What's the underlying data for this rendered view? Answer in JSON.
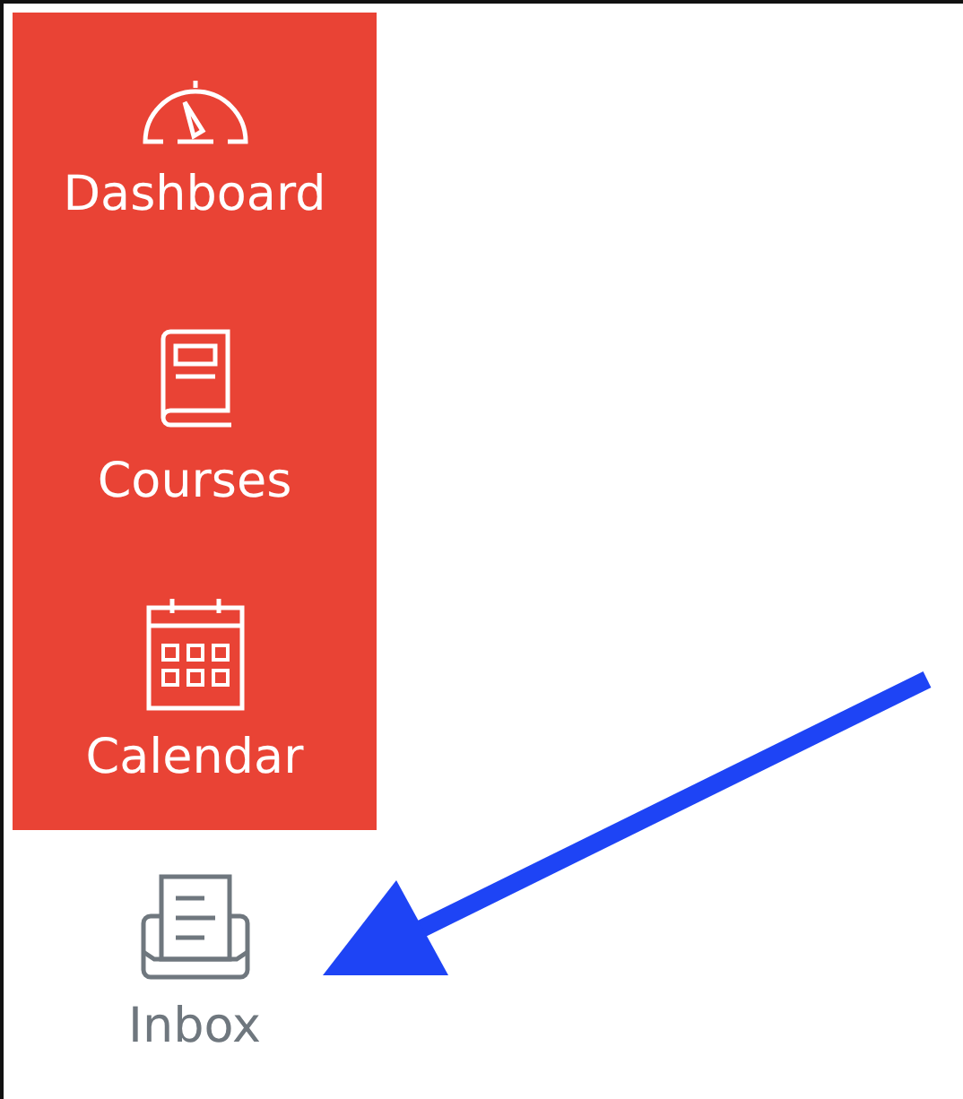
{
  "nav_items": [
    {
      "label": "Dashboard",
      "kind": "dashboard",
      "highlighted": true
    },
    {
      "label": "Courses",
      "kind": "courses",
      "highlighted": true
    },
    {
      "label": "Calendar",
      "kind": "calendar",
      "highlighted": true
    },
    {
      "label": "Inbox",
      "kind": "inbox",
      "highlighted": false
    }
  ]
}
